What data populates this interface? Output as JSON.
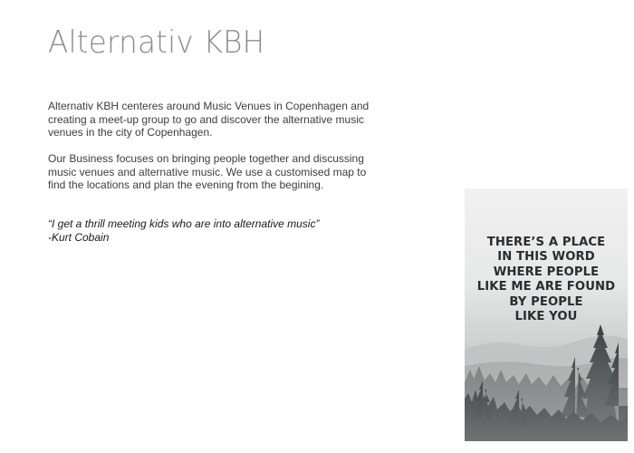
{
  "page": {
    "title": "Alternativ KBH",
    "paragraphs": [
      "Alternativ KBH centeres around Music Venues in Copenhagen and creating a meet-up group to go and discover the alternative music venues in the city of Copenhagen.",
      "Our Business focuses on bringing people together and discussing music venues and alternative music. We use a customised map to find the locations and plan the evening from the begining."
    ],
    "quote": {
      "text": "“I get a thrill meeting kids who are into alternative music”",
      "author": "-Kurt Cobain"
    }
  },
  "poster": {
    "lines": [
      "THERE’S A PLACE",
      "IN THIS WORD",
      "WHERE PEOPLE",
      "LIKE ME ARE FOUND",
      "BY PEOPLE",
      "LIKE YOU"
    ],
    "depicts": "misty-pine-forest"
  }
}
